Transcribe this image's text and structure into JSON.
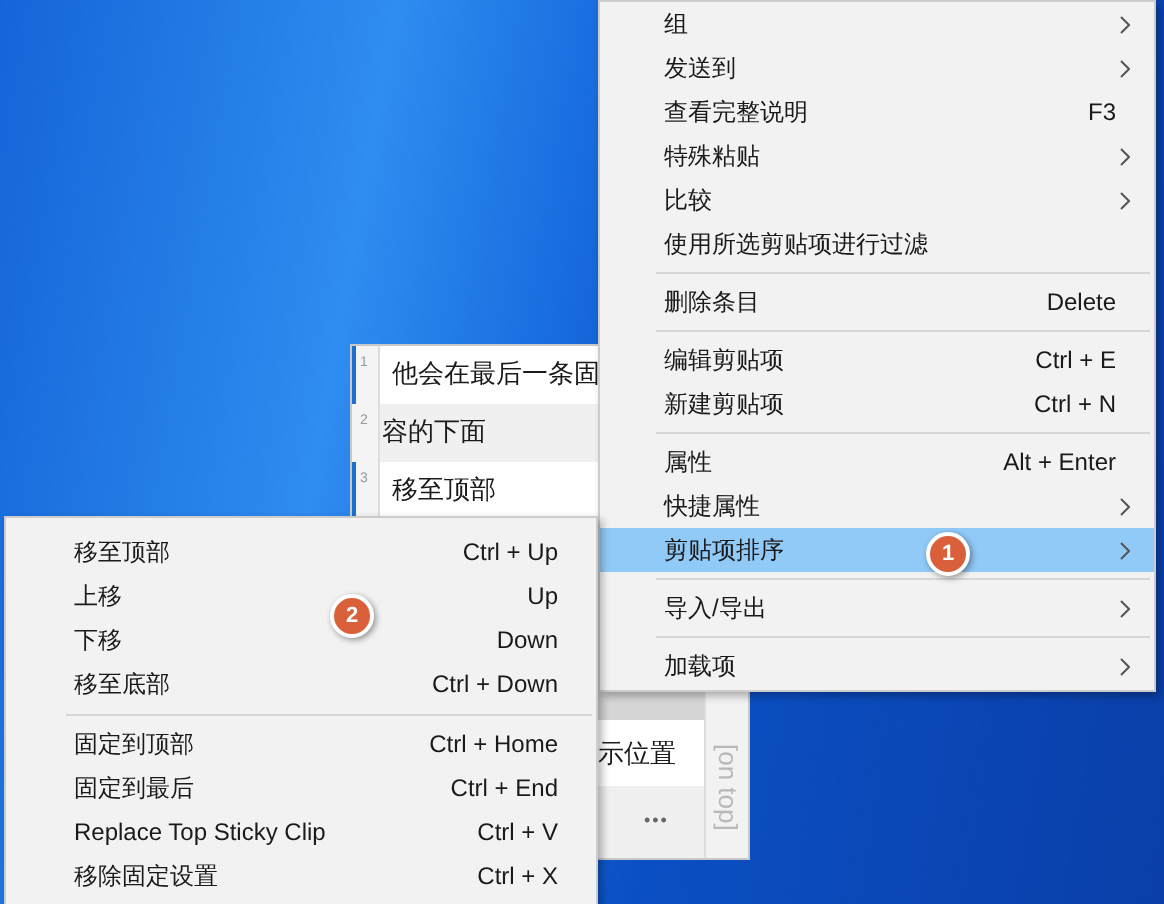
{
  "clipboard_window": {
    "rows": [
      {
        "number": "1",
        "text": "他会在最后一条固",
        "marked": true,
        "selected": false
      },
      {
        "number": "2",
        "text": "容的下面",
        "marked": false,
        "selected": true
      },
      {
        "number": "3",
        "text": "移至顶部",
        "marked": true,
        "selected": false
      }
    ],
    "lower_row_text": "示位置",
    "more_button": "•••",
    "tag": "[on top]"
  },
  "context_menu": {
    "badge": "1",
    "sections": [
      {
        "items": [
          {
            "label": "组",
            "has_submenu": true,
            "selected": false
          },
          {
            "label": "发送到",
            "has_submenu": true,
            "selected": false
          },
          {
            "label": "查看完整说明",
            "shortcut": "F3",
            "has_submenu": false,
            "selected": false
          },
          {
            "label": "特殊粘贴",
            "has_submenu": true,
            "selected": false
          },
          {
            "label": "比较",
            "has_submenu": true,
            "selected": false
          },
          {
            "label": "使用所选剪贴项进行过滤",
            "has_submenu": false,
            "selected": false
          }
        ]
      },
      {
        "items": [
          {
            "label": "删除条目",
            "shortcut": "Delete",
            "has_submenu": false,
            "selected": false
          }
        ]
      },
      {
        "items": [
          {
            "label": "编辑剪贴项",
            "shortcut": "Ctrl + E",
            "has_submenu": false,
            "selected": false
          },
          {
            "label": "新建剪贴项",
            "shortcut": "Ctrl + N",
            "has_submenu": false,
            "selected": false
          }
        ]
      },
      {
        "items": [
          {
            "label": "属性",
            "shortcut": "Alt + Enter",
            "has_submenu": false,
            "selected": false
          },
          {
            "label": "快捷属性",
            "has_submenu": true,
            "selected": false
          },
          {
            "label": "剪贴项排序",
            "has_submenu": true,
            "selected": true
          }
        ]
      },
      {
        "items": [
          {
            "label": "导入/导出",
            "has_submenu": true,
            "selected": false
          }
        ]
      },
      {
        "items": [
          {
            "label": "加载项",
            "has_submenu": true,
            "selected": false
          }
        ]
      }
    ]
  },
  "submenu": {
    "badge": "2",
    "sections": [
      {
        "items": [
          {
            "label": "移至顶部",
            "shortcut": "Ctrl + Up"
          },
          {
            "label": "上移",
            "shortcut": "Up"
          },
          {
            "label": "下移",
            "shortcut": "Down"
          },
          {
            "label": "移至底部",
            "shortcut": "Ctrl + Down"
          }
        ]
      },
      {
        "items": [
          {
            "label": "固定到顶部",
            "shortcut": "Ctrl + Home"
          },
          {
            "label": "固定到最后",
            "shortcut": "Ctrl + End"
          },
          {
            "label": "Replace Top Sticky Clip",
            "shortcut": "Ctrl + V"
          },
          {
            "label": "移除固定设置",
            "shortcut": "Ctrl + X"
          }
        ]
      }
    ]
  }
}
